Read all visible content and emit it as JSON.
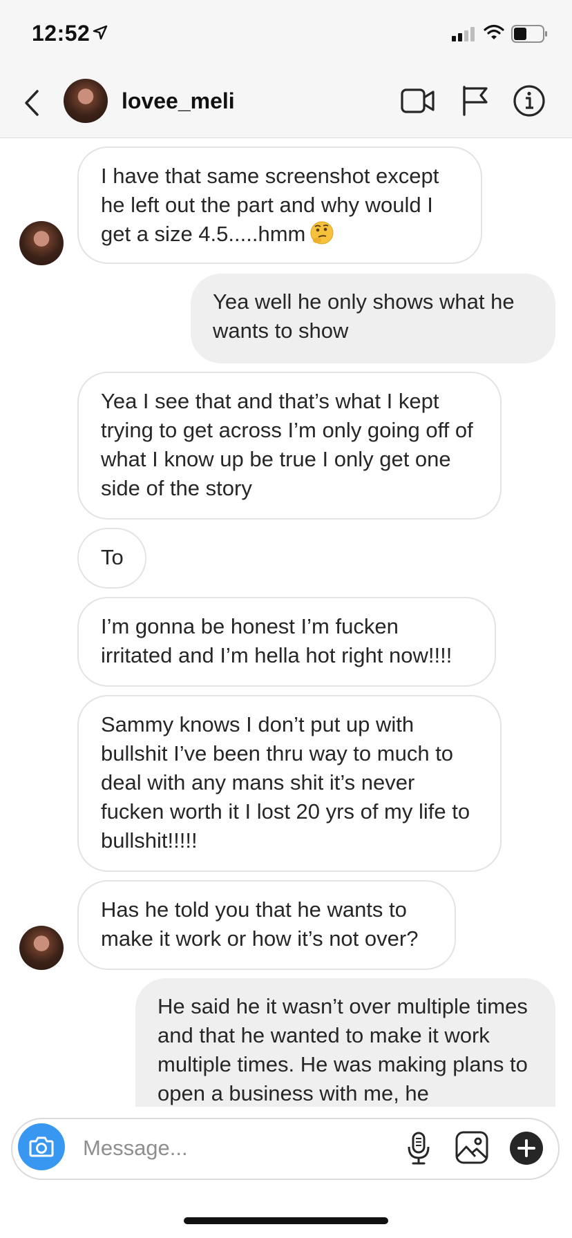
{
  "status_bar": {
    "time": "12:52"
  },
  "header": {
    "username": "lovee_meli"
  },
  "messages": [
    {
      "from": "them",
      "text": "I have that same screenshot except he left out the part and why would I get a size 4.5.....hmm",
      "emoji": "thinking-face"
    },
    {
      "from": "me",
      "text": "Yea well he only shows what he wants to show"
    },
    {
      "from": "them",
      "text": "Yea I see that and that’s what I kept trying to get across I’m only going off of what I know up be true I only get one side of the story"
    },
    {
      "from": "them",
      "text": "To"
    },
    {
      "from": "them",
      "text": "I’m gonna be honest I’m fucken irritated and I’m hella hot right now!!!!"
    },
    {
      "from": "them",
      "text": "Sammy knows I don’t put up with bullshit I’ve been thru way to much to deal with any mans shit it’s never fucken worth it I lost 20 yrs of my life to bullshit!!!!!"
    },
    {
      "from": "them",
      "text": "Has he told you that he wants to make it work or how it’s not over?"
    },
    {
      "from": "me",
      "text": "He said he it wasn’t over multiple times and that he wanted to make it work multiple times. He was making plans to open a business with me, he"
    }
  ],
  "composer": {
    "placeholder": "Message..."
  },
  "icons": {
    "back": "chevron-left-icon",
    "video": "video-camera-icon",
    "flag": "flag-icon",
    "info": "info-icon",
    "camera": "camera-icon",
    "mic": "microphone-icon",
    "gallery": "image-gallery-icon",
    "add": "plus-icon"
  },
  "colors": {
    "accent": "#3897f0",
    "incoming_bubble_border": "#e3e3e3",
    "outgoing_bubble_bg": "#efefef"
  }
}
